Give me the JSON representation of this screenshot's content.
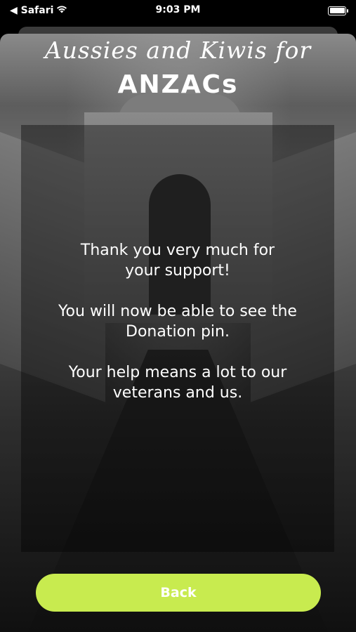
{
  "status_bar": {
    "back_app": "◀ Safari",
    "time": "9:03 PM",
    "wifi_icon": "wifi-icon",
    "battery_icon": "battery-icon"
  },
  "header": {
    "title_script": "Aussies and Kiwis for",
    "title_main": "ANZACs"
  },
  "message": {
    "lines": [
      "Thank you very much for\nyour support!",
      "You will now be able to see the\nDonation pin.",
      "Your help means a lot to our\nveterans and us."
    ]
  },
  "actions": {
    "back_label": "Back"
  },
  "colors": {
    "button_bg": "#c8eb4f",
    "button_text": "#ffffff",
    "overlay": "rgba(0,0,0,0.38)"
  }
}
